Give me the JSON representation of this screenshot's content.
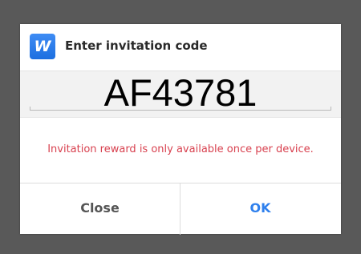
{
  "dialog": {
    "icon": {
      "name": "app-logo-icon",
      "letter": "W",
      "color": "#2f7ff0"
    },
    "title": "Enter invitation code",
    "code_value": "AF43781",
    "message": "Invitation reward is only available once per device.",
    "message_color": "#d8414f",
    "buttons": {
      "close_label": "Close",
      "ok_label": "OK",
      "ok_color": "#2f80ed"
    }
  }
}
